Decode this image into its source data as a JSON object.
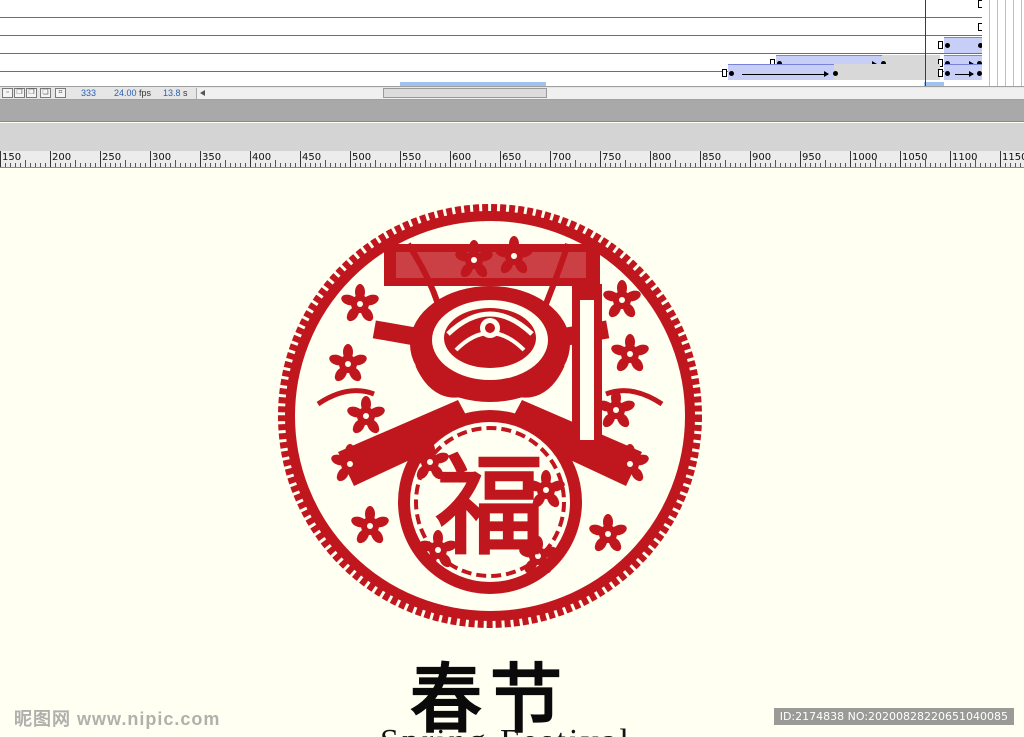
{
  "timeline": {
    "frame_count": "333",
    "fps": "24.00",
    "fps_unit": "fps",
    "duration": "13.8",
    "duration_unit": "s"
  },
  "ruler": {
    "labels": [
      "150",
      "200",
      "250",
      "300",
      "350",
      "400",
      "450",
      "500",
      "550",
      "600",
      "650",
      "700",
      "750",
      "800",
      "850",
      "900",
      "950",
      "1000",
      "1050",
      "1100",
      "1150"
    ]
  },
  "stage": {
    "papercut_color": "#c0161e",
    "chinese_title": "春节",
    "english_title": "Spring Festival",
    "center_character": "福"
  },
  "watermark": {
    "site": "昵图网 www.nipic.com",
    "id_text": "ID:2174838 NO:20200828220651040085"
  }
}
